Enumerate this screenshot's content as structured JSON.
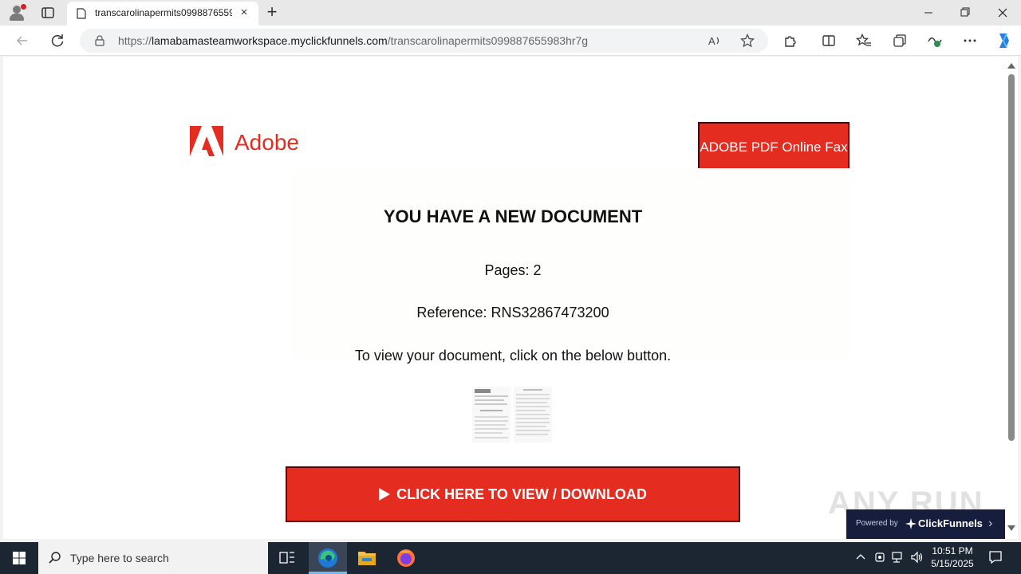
{
  "browser": {
    "tab_title": "transcarolinapermits0998876559",
    "url_domain": "lamabamasteamworkspace.myclickfunnels.com",
    "url_prefix": "https://",
    "url_path": "/transcarolinapermits099887655983hr7g"
  },
  "page": {
    "brand": "Adobe",
    "fax_badge": "ADOBE PDF Online Fax",
    "heading": "YOU HAVE A NEW DOCUMENT",
    "pages_line": "Pages: 2",
    "reference_line": "Reference: RNS32867473200",
    "instruction": "To view your document, click on the below button.",
    "cta_label": "CLICK HERE TO VIEW / DOWNLOAD",
    "clickfunnels_powered": "Powered by",
    "clickfunnels_name": "ClickFunnels",
    "watermark": "ANY RUN"
  },
  "taskbar": {
    "search_placeholder": "Type here to search",
    "time": "10:51 PM",
    "date": "5/15/2025"
  },
  "colors": {
    "adobe_red": "#e42c20",
    "badge_border": "#5c0000",
    "clickfunnels_navy": "#171d3d",
    "taskbar": "#1c2532"
  }
}
